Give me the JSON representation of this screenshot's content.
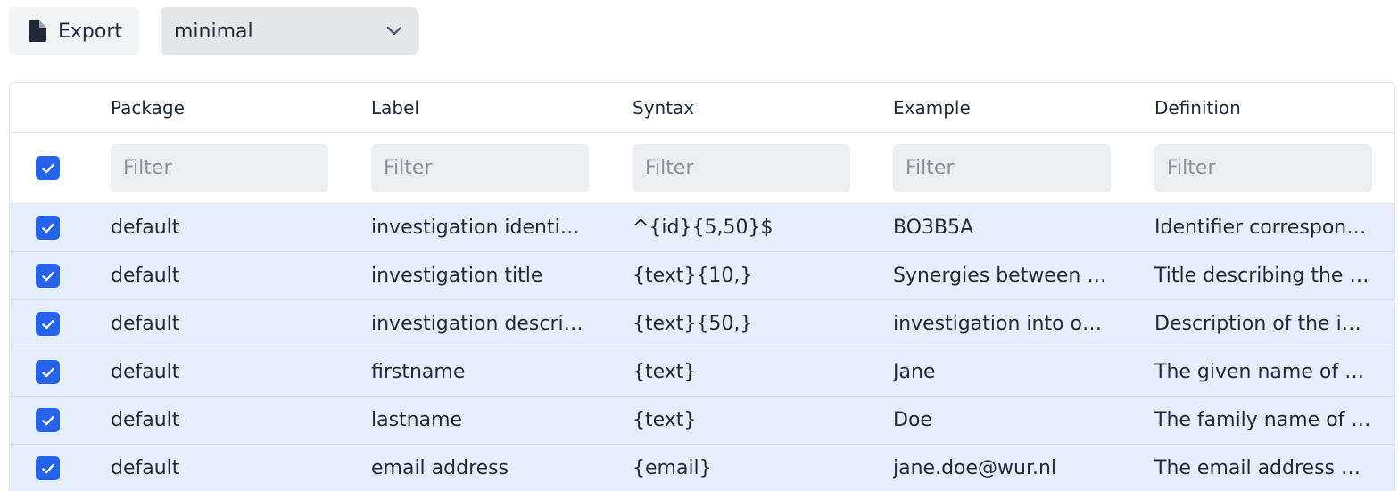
{
  "toolbar": {
    "export_label": "Export",
    "export_icon": "file-icon",
    "select_value": "minimal",
    "select_icon": "chevron-down-icon"
  },
  "colors": {
    "accent": "#2563eb",
    "row_selected_bg": "#e6eefc",
    "button_bg": "#f3f4f6",
    "filter_bg": "#eceef1"
  },
  "table": {
    "columns": [
      "Package",
      "Label",
      "Syntax",
      "Example",
      "Definition"
    ],
    "filter_placeholder": "Filter",
    "select_all_checked": true,
    "rows": [
      {
        "checked": true,
        "package": "default",
        "label": "investigation identifier",
        "syntax": "^{id}{5,50}$",
        "example": "BO3B5A",
        "definition": "Identifier correspond…"
      },
      {
        "checked": true,
        "package": "default",
        "label": "investigation title",
        "syntax": "{text}{10,}",
        "example": "Synergies between bi…",
        "definition": "Title describing the i…"
      },
      {
        "checked": true,
        "package": "default",
        "label": "investigation descript…",
        "syntax": "{text}{50,}",
        "example": "investigation into opt…",
        "definition": "Description of the inv…"
      },
      {
        "checked": true,
        "package": "default",
        "label": "firstname",
        "syntax": "{text}",
        "example": "Jane",
        "definition": "The given name of a …"
      },
      {
        "checked": true,
        "package": "default",
        "label": "lastname",
        "syntax": "{text}",
        "example": "Doe",
        "definition": "The family name of a…"
      },
      {
        "checked": true,
        "package": "default",
        "label": "email address",
        "syntax": "{email}",
        "example": "jane.doe@wur.nl",
        "definition": "The email address of …"
      }
    ]
  }
}
